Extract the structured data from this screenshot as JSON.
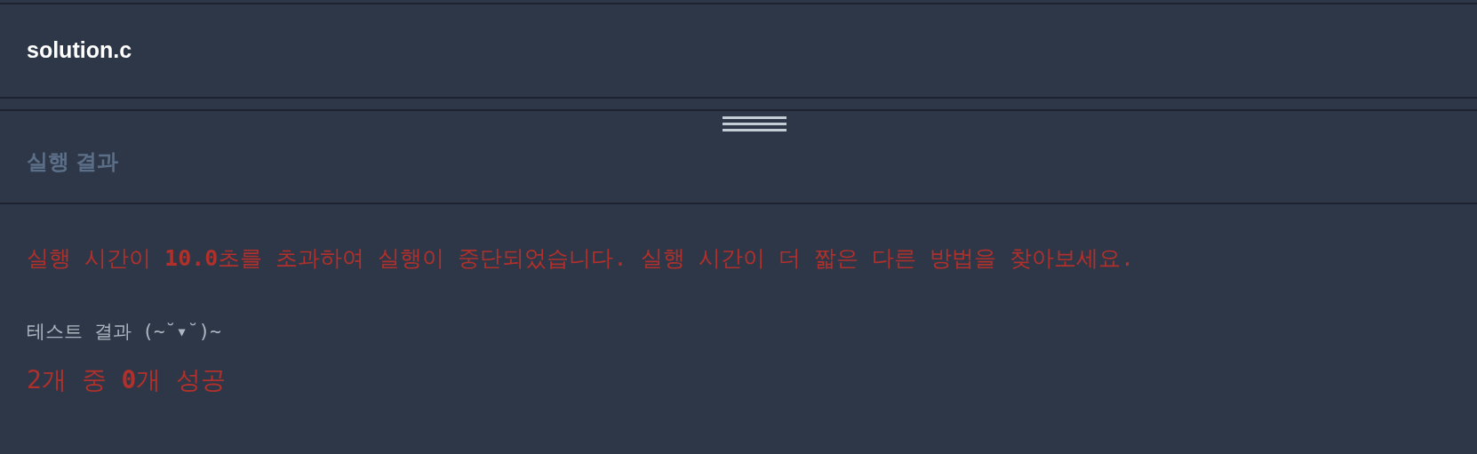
{
  "file_tab": {
    "title": "solution.c"
  },
  "results_panel": {
    "title": "실행 결과"
  },
  "output": {
    "error_message": "실행 시간이 **10.0**초를 초과하여 실행이 중단되었습니다. 실행 시간이 더 짧은 다른 방법을 찾아보세요.",
    "test_heading": "테스트 결과 (~˘▾˘)~",
    "summary": "2개 중 **0**개 성공"
  }
}
